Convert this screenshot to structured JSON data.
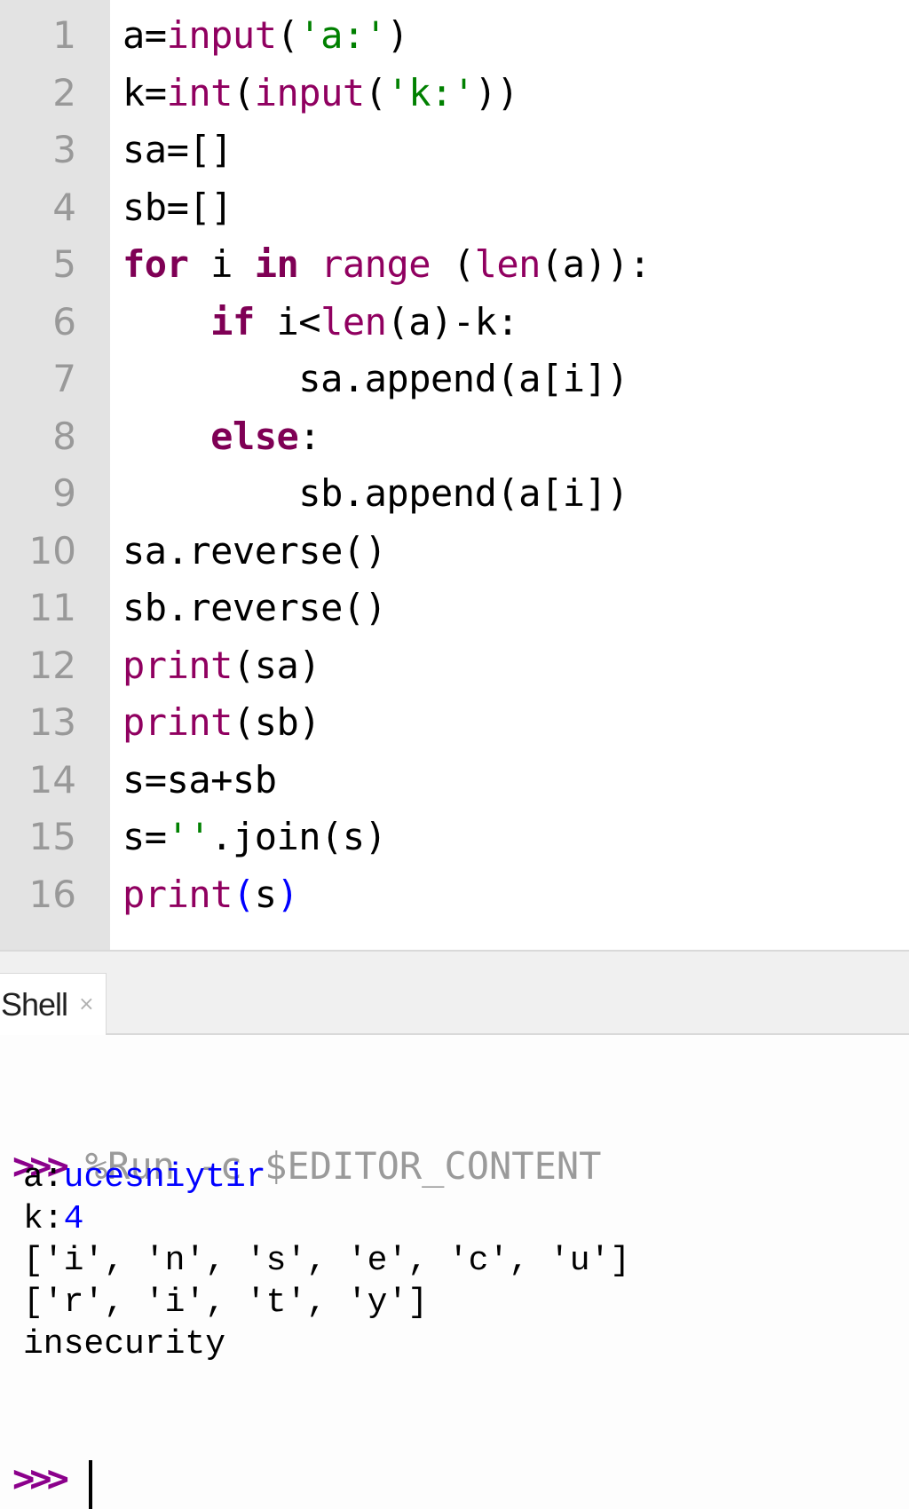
{
  "editor": {
    "line_numbers": [
      "1",
      "2",
      "3",
      "4",
      "5",
      "6",
      "7",
      "8",
      "9",
      "10",
      "11",
      "12",
      "13",
      "14",
      "15",
      "16"
    ],
    "lines": [
      [
        {
          "t": "a=",
          "c": "plain"
        },
        {
          "t": "input",
          "c": "builtin"
        },
        {
          "t": "(",
          "c": "plain"
        },
        {
          "t": "'a:'",
          "c": "str"
        },
        {
          "t": ")",
          "c": "plain"
        }
      ],
      [
        {
          "t": "k=",
          "c": "plain"
        },
        {
          "t": "int",
          "c": "builtin"
        },
        {
          "t": "(",
          "c": "plain"
        },
        {
          "t": "input",
          "c": "builtin"
        },
        {
          "t": "(",
          "c": "plain"
        },
        {
          "t": "'k:'",
          "c": "str"
        },
        {
          "t": "))",
          "c": "plain"
        }
      ],
      [
        {
          "t": "sa=[]",
          "c": "plain"
        }
      ],
      [
        {
          "t": "sb=[]",
          "c": "plain"
        }
      ],
      [
        {
          "t": "for",
          "c": "kw"
        },
        {
          "t": " i ",
          "c": "plain"
        },
        {
          "t": "in",
          "c": "kw"
        },
        {
          "t": " ",
          "c": "plain"
        },
        {
          "t": "range",
          "c": "builtin"
        },
        {
          "t": " (",
          "c": "plain"
        },
        {
          "t": "len",
          "c": "builtin"
        },
        {
          "t": "(a)):",
          "c": "plain"
        }
      ],
      [
        {
          "t": "    ",
          "c": "plain"
        },
        {
          "t": "if",
          "c": "kw"
        },
        {
          "t": " i<",
          "c": "plain"
        },
        {
          "t": "len",
          "c": "builtin"
        },
        {
          "t": "(a)-k:",
          "c": "plain"
        }
      ],
      [
        {
          "t": "        sa.append(a[i])",
          "c": "plain"
        }
      ],
      [
        {
          "t": "    ",
          "c": "plain"
        },
        {
          "t": "else",
          "c": "kw"
        },
        {
          "t": ":",
          "c": "plain"
        }
      ],
      [
        {
          "t": "        sb.append(a[i])",
          "c": "plain"
        }
      ],
      [
        {
          "t": "sa.reverse()",
          "c": "plain"
        }
      ],
      [
        {
          "t": "sb.reverse()",
          "c": "plain"
        }
      ],
      [
        {
          "t": "print",
          "c": "builtin"
        },
        {
          "t": "(sa)",
          "c": "plain"
        }
      ],
      [
        {
          "t": "print",
          "c": "builtin"
        },
        {
          "t": "(sb)",
          "c": "plain"
        }
      ],
      [
        {
          "t": "s=sa+sb",
          "c": "plain"
        }
      ],
      [
        {
          "t": "s=",
          "c": "plain"
        },
        {
          "t": "''",
          "c": "str"
        },
        {
          "t": ".join(s)",
          "c": "plain"
        }
      ],
      [
        {
          "t": "print",
          "c": "builtin"
        },
        {
          "t": "(",
          "c": "paren-match"
        },
        {
          "t": "s",
          "c": "plain"
        },
        {
          "t": ")",
          "c": "paren-match"
        }
      ]
    ]
  },
  "tabs": {
    "shell_label": "Shell",
    "close_glyph": "×"
  },
  "shell": {
    "prompt": ">>>",
    "run_command": "%Run -c $EDITOR_CONTENT",
    "outputs": [
      {
        "prefix": "a:",
        "input": "ucesniytir"
      },
      {
        "prefix": "k:",
        "input": "4"
      },
      {
        "prefix": "['i', 'n', 's', 'e', 'c', 'u']",
        "input": ""
      },
      {
        "prefix": "['r', 'i', 't', 'y']",
        "input": ""
      },
      {
        "prefix": "insecurity",
        "input": ""
      }
    ],
    "final_prompt": ">>>"
  },
  "colors": {
    "keyword": "#7f0055",
    "builtin": "#900060",
    "string": "#008000",
    "user_input": "#0000ff",
    "prompt": "#8b008b",
    "gutter_bg": "#e3e3e3",
    "tabbar_bg": "#f0f0f0"
  }
}
